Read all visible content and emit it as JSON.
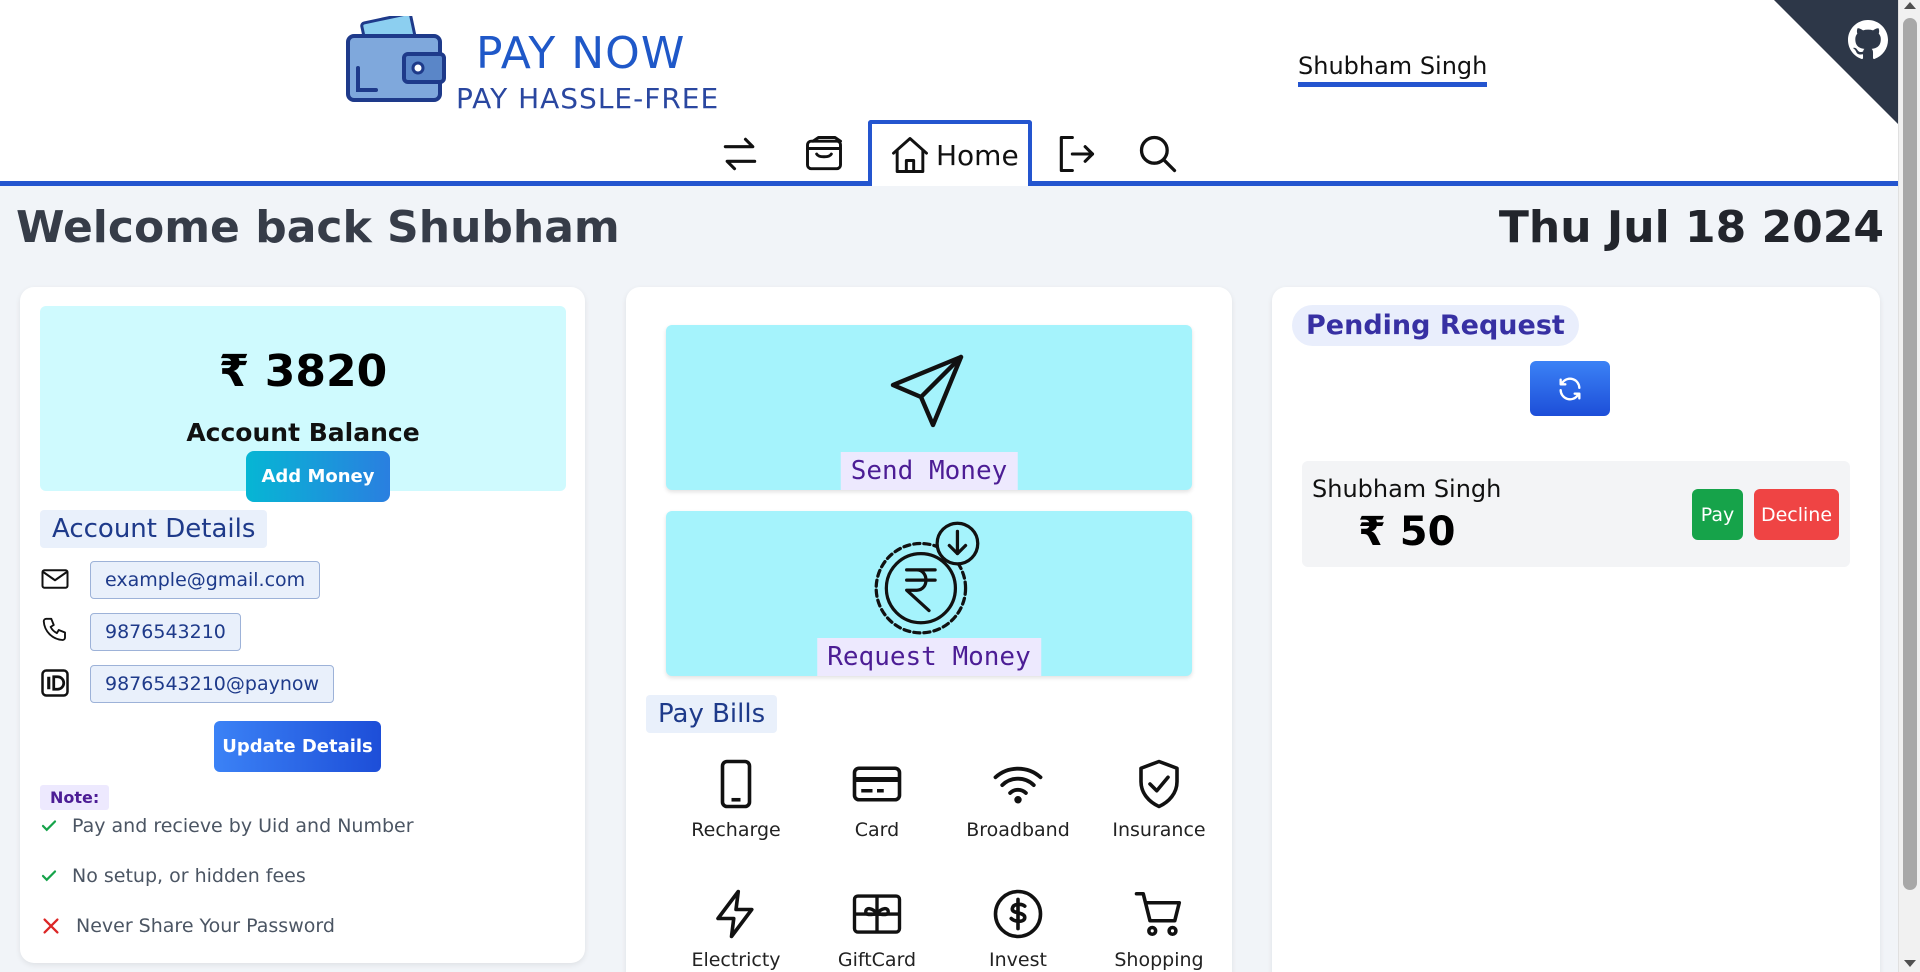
{
  "brand": {
    "title": "PAY NOW",
    "subtitle": "PAY HASSLE-FREE"
  },
  "header": {
    "user_name": "Shubham Singh"
  },
  "nav": {
    "items": [
      "transfer-icon",
      "wallet-icon",
      "home-icon",
      "logout-icon",
      "search-icon"
    ],
    "active_label": "Home"
  },
  "welcome": {
    "text": "Welcome back Shubham",
    "date": "Thu Jul 18 2024"
  },
  "balance": {
    "amount": "₹ 3820",
    "label": "Account Balance",
    "add_money_label": "Add Money"
  },
  "account_details": {
    "title": "Account Details",
    "email": "example@gmail.com",
    "phone": "9876543210",
    "upi": "9876543210@paynow",
    "update_label": "Update Details"
  },
  "note": {
    "label": "Note:",
    "items": [
      "Pay and recieve by Uid and Number",
      "No setup, or hidden fees",
      "Never Share Your Password"
    ]
  },
  "actions": {
    "send_label": "Send Money",
    "request_label": "Request Money"
  },
  "bills": {
    "title": "Pay Bills",
    "items": [
      "Recharge",
      "Card",
      "Broadband",
      "Insurance",
      "Electricty",
      "GiftCard",
      "Invest",
      "Shopping"
    ]
  },
  "pending": {
    "title": "Pending Request",
    "requests": [
      {
        "name": "Shubham Singh",
        "amount": "₹ 50",
        "pay_label": "Pay",
        "decline_label": "Decline"
      }
    ]
  },
  "colors": {
    "accent": "#2455cf",
    "balance_bg": "#cffafe",
    "action_bg": "#a5f3fc",
    "pay_green": "#16a34a",
    "decline_red": "#ef4444"
  }
}
